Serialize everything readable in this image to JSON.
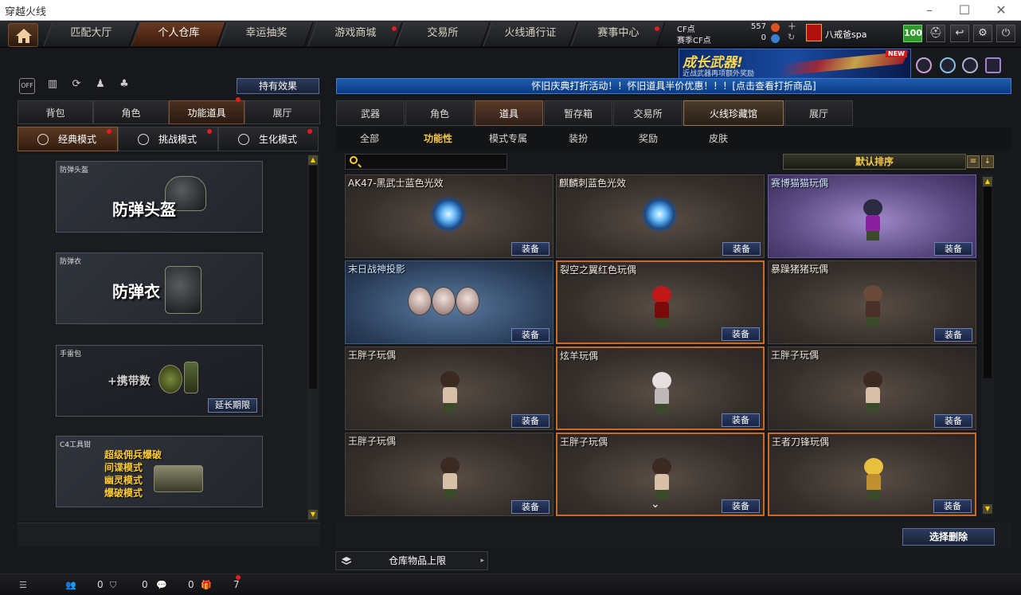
{
  "window": {
    "title": "穿越火线"
  },
  "nav": {
    "tabs": [
      {
        "label": "匹配大厅",
        "active": false,
        "dot": false
      },
      {
        "label": "个人仓库",
        "active": true,
        "dot": false
      },
      {
        "label": "幸运抽奖",
        "active": false,
        "dot": false
      },
      {
        "label": "游戏商城",
        "active": false,
        "dot": true
      },
      {
        "label": "交易所",
        "active": false,
        "dot": false
      },
      {
        "label": "火线通行证",
        "active": false,
        "dot": false
      },
      {
        "label": "赛事中心",
        "active": false,
        "dot": true
      }
    ]
  },
  "currency": {
    "cf_label": "CF点",
    "cf_value": "557",
    "season_label": "赛季CF点",
    "season_value": "0"
  },
  "user": {
    "name": "八戒爸spa",
    "level": "100"
  },
  "banner": {
    "title": "成长武器!",
    "subtitle": "近战武器再项额外奖励",
    "badge": "NEW"
  },
  "left": {
    "hold_effect": "持有效果",
    "tabs": [
      "背包",
      "角色",
      "功能道具",
      "展厅"
    ],
    "active_tab": "功能道具",
    "modes": [
      {
        "label": "经典模式",
        "active": true
      },
      {
        "label": "挑战模式",
        "active": false
      },
      {
        "label": "生化模式",
        "active": false
      }
    ],
    "cards": [
      {
        "title": "防弹头盔",
        "big": "防弹头盔"
      },
      {
        "title": "防弹衣",
        "big": "防弹衣"
      },
      {
        "title": "手雷包",
        "big": "+携带数",
        "button": "延长期限"
      },
      {
        "title": "C4工具钳",
        "lines": [
          "超级佣兵爆破",
          "间谍模式",
          "幽灵模式",
          "爆破模式"
        ]
      }
    ]
  },
  "right": {
    "notice": "怀旧庆典打折活动！！怀旧道具半价优惠！！！[点击查看打折商品]",
    "tabs": [
      "武器",
      "角色",
      "道具",
      "暂存箱",
      "交易所",
      "火线珍藏馆",
      "展厅"
    ],
    "active_tab": "道具",
    "subtabs": [
      "全部",
      "功能性",
      "模式专属",
      "装扮",
      "奖励",
      "皮肤"
    ],
    "active_subtab": "功能性",
    "sort_label": "默认排序",
    "equip_label": "装备",
    "items": [
      {
        "name": "AK47-黑武士蓝色光效",
        "kind": "glow",
        "style": ""
      },
      {
        "name": "麒麟刺蓝色光效",
        "kind": "glow",
        "style": ""
      },
      {
        "name": "赛博猫猫玩偶",
        "kind": "cat",
        "style": "purple"
      },
      {
        "name": "末日战神投影",
        "kind": "heads",
        "style": "blue"
      },
      {
        "name": "裂空之翼红色玩偶",
        "kind": "red",
        "style": "sel"
      },
      {
        "name": "暴躁猪猪玩偶",
        "kind": "pig",
        "style": ""
      },
      {
        "name": "王胖子玩偶",
        "kind": "wang",
        "style": ""
      },
      {
        "name": "炫羊玩偶",
        "kind": "sheep",
        "style": "sel"
      },
      {
        "name": "王胖子玩偶",
        "kind": "wang",
        "style": ""
      },
      {
        "name": "王胖子玩偶",
        "kind": "wang",
        "style": ""
      },
      {
        "name": "王胖子玩偶",
        "kind": "wang",
        "style": "sel"
      },
      {
        "name": "王者刀锋玩偶",
        "kind": "gold",
        "style": "sel"
      }
    ],
    "delete_select": "选择删除",
    "storage_limit": "仓库物品上限"
  },
  "status": {
    "friends": "0",
    "shield": "0",
    "chat": "0",
    "gift": "7"
  }
}
